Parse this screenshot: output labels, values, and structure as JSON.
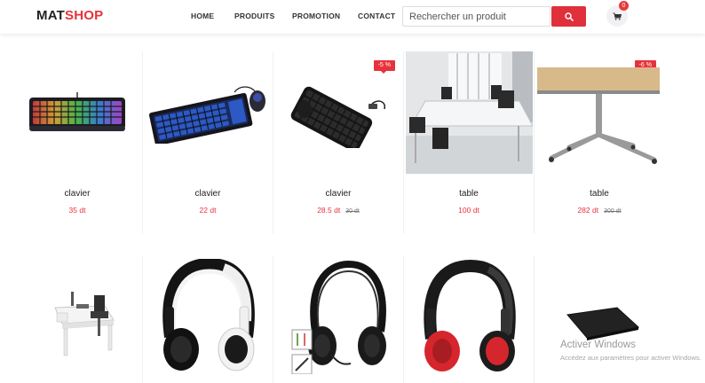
{
  "header": {
    "logo_part1": "MAT",
    "logo_part2": "SHOP",
    "nav": [
      "HOME",
      "PRODUITS",
      "PROMOTION",
      "CONTACT"
    ],
    "search_placeholder": "Rechercher un produit",
    "cart_count": "0"
  },
  "colors": {
    "accent": "#e8323b",
    "text": "#222222"
  },
  "products_row1": [
    {
      "name": "clavier",
      "price": "35 dt",
      "old_price": "",
      "promo": "",
      "image": "rgb-gaming-keyboard"
    },
    {
      "name": "clavier",
      "price": "22 dt",
      "old_price": "",
      "promo": "",
      "image": "keyboard-and-mouse"
    },
    {
      "name": "clavier",
      "price": "28.5 dt",
      "old_price": "30 dt",
      "promo": "-5 %",
      "image": "flexible-silicone-keyboard"
    },
    {
      "name": "table",
      "price": "100 dt",
      "old_price": "",
      "promo": "",
      "image": "office-room-desks"
    },
    {
      "name": "table",
      "price": "282 dt",
      "old_price": "300 dt",
      "promo": "-6 %",
      "image": "wooden-top-table"
    }
  ],
  "products_row2": [
    {
      "image": "white-desk-with-chair"
    },
    {
      "image": "white-black-headphones"
    },
    {
      "image": "black-headset-with-jack"
    },
    {
      "image": "red-black-headphones"
    },
    {
      "image": "black-mouse-pad"
    }
  ],
  "watermark": {
    "title": "Activer Windows",
    "subtitle": "Accédez aux paramètres pour activer Windows."
  }
}
